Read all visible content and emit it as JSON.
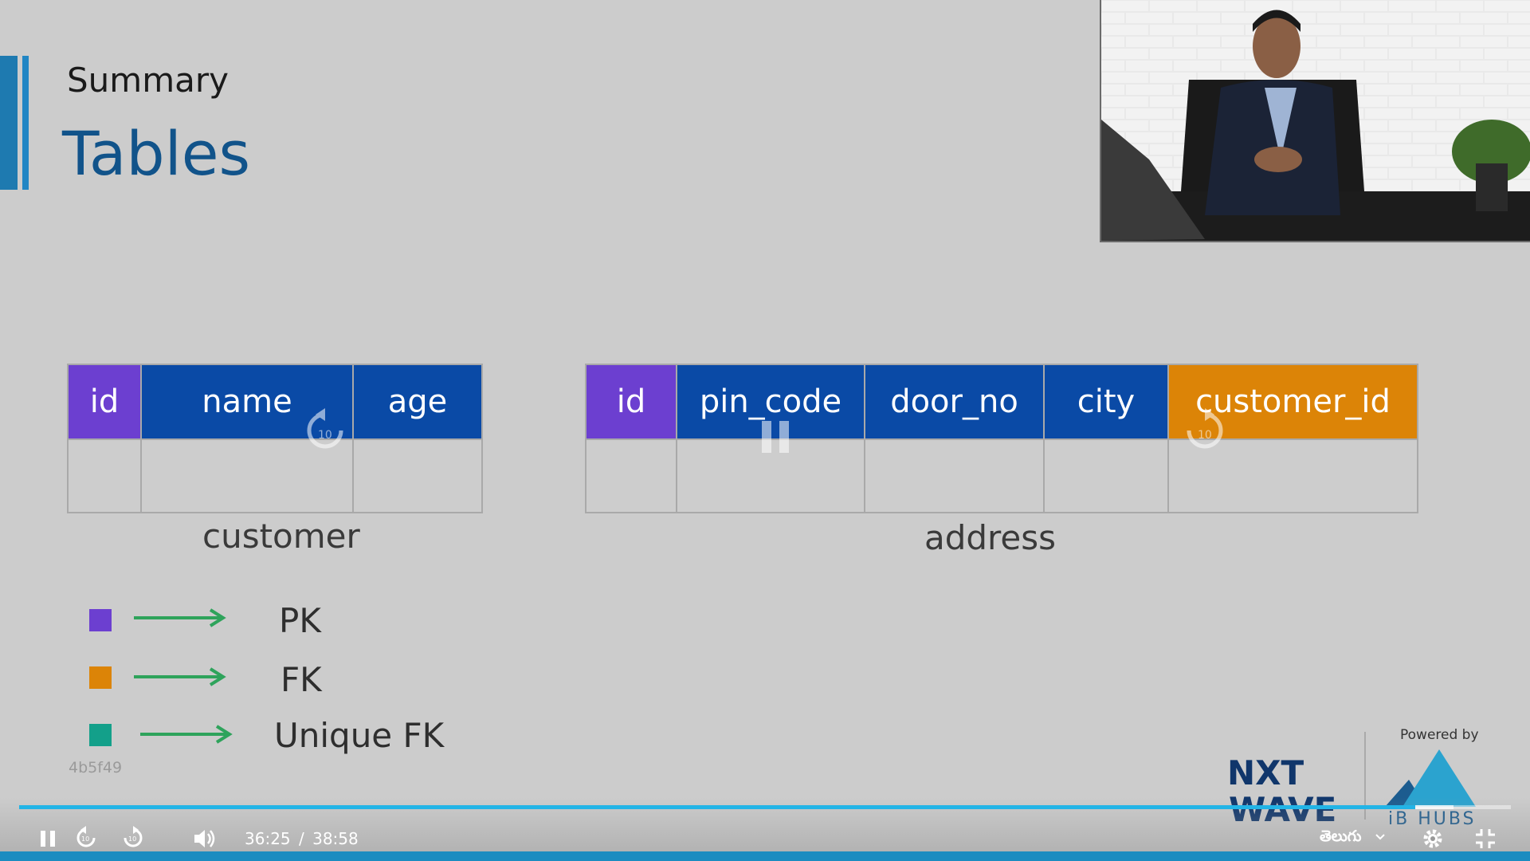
{
  "slide": {
    "section_label": "Summary",
    "title": "Tables",
    "customer_table": {
      "columns": [
        "id",
        "name",
        "age"
      ],
      "caption": "customer"
    },
    "address_table": {
      "columns": [
        "id",
        "pin_code",
        "door_no",
        "city",
        "customer_id"
      ],
      "caption": "address"
    },
    "legend": [
      {
        "color": "#6c3fd0",
        "label": "PK"
      },
      {
        "color": "#dc8407",
        "label": "FK"
      },
      {
        "color": "#13a08a",
        "label": "Unique FK"
      }
    ],
    "watermark_code": "4b5f49"
  },
  "brand": {
    "powered_by": "Powered by",
    "logo_left": "NXT WAVE",
    "logo_right": "iB HUBS"
  },
  "player": {
    "current_time": "36:25",
    "separator": "/",
    "duration": "38:58",
    "progress_fraction": 0.936,
    "language": "తెలుగు",
    "accent_color": "#22b4e6",
    "icons": [
      "pause-icon",
      "rewind-10-icon",
      "forward-10-icon",
      "volume-icon",
      "gear-icon",
      "exit-fullscreen-icon"
    ]
  }
}
